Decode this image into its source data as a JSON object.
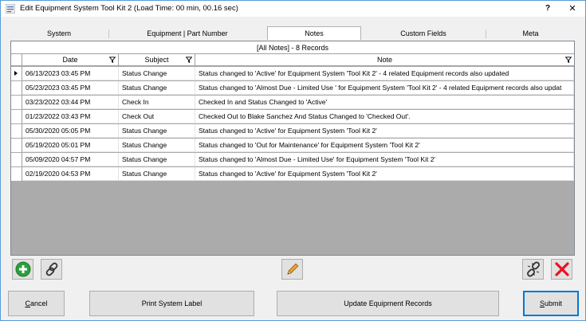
{
  "window": {
    "title": "Edit Equipment System Tool Kit 2 (Load Time: 00 min, 00.16 sec)",
    "help_label": "?",
    "close_label": "✕"
  },
  "tabs": [
    {
      "label": "System"
    },
    {
      "label": "Equipment | Part Number"
    },
    {
      "label": "Notes"
    },
    {
      "label": "Custom Fields"
    },
    {
      "label": "Meta"
    }
  ],
  "active_tab": "Notes",
  "grid": {
    "caption": "[All Notes] - 8 Records",
    "columns": [
      "Date",
      "Subject",
      "Note"
    ],
    "rows": [
      {
        "date": "06/13/2023 03:45 PM",
        "subject": "Status Change",
        "note": "Status changed to 'Active' for Equipment System 'Tool Kit 2' - 4 related Equipment records also updated",
        "current": true
      },
      {
        "date": "05/23/2023 03:45 PM",
        "subject": "Status Change",
        "note": "Status changed to 'Almost Due - Limited Use ' for Equipment System 'Tool Kit 2' - 4 related Equipment records also updat",
        "current": false
      },
      {
        "date": "03/23/2022 03:44 PM",
        "subject": "Check In",
        "note": "Checked In and Status Changed to 'Active'",
        "current": false
      },
      {
        "date": "01/23/2022 03:43 PM",
        "subject": "Check Out",
        "note": "Checked Out to Blake Sanchez And Status Changed to 'Checked Out'.",
        "current": false
      },
      {
        "date": "05/30/2020 05:05 PM",
        "subject": "Status Change",
        "note": "Status changed to 'Active' for Equipment System 'Tool Kit 2'",
        "current": false
      },
      {
        "date": "05/19/2020 05:01 PM",
        "subject": "Status Change",
        "note": "Status changed to 'Out for Maintenance' for Equipment System 'Tool Kit 2'",
        "current": false
      },
      {
        "date": "05/09/2020 04:57 PM",
        "subject": "Status Change",
        "note": "Status changed to 'Almost Due - Limited Use' for Equipment System 'Tool Kit 2'",
        "current": false
      },
      {
        "date": "02/19/2020 04:53 PM",
        "subject": "Status Change",
        "note": "Status changed to 'Active' for Equipment System 'Tool Kit 2'",
        "current": false
      }
    ]
  },
  "toolbar": {
    "add_icon": "add-circle-icon",
    "link_icon": "link-icon",
    "edit_icon": "pencil-icon",
    "unlink_icon": "unlink-icon",
    "delete_icon": "delete-x-icon"
  },
  "buttons": {
    "cancel": {
      "accel": "C",
      "rest": "ancel"
    },
    "print_label": "Print System Label",
    "update_label": "Update Equipment Records",
    "submit": {
      "accel": "S",
      "rest": "ubmit"
    }
  },
  "colors": {
    "accent": "#0078d7",
    "add_green": "#2e9e3e",
    "delete_red": "#e81123",
    "pencil_orange": "#f0a030"
  }
}
